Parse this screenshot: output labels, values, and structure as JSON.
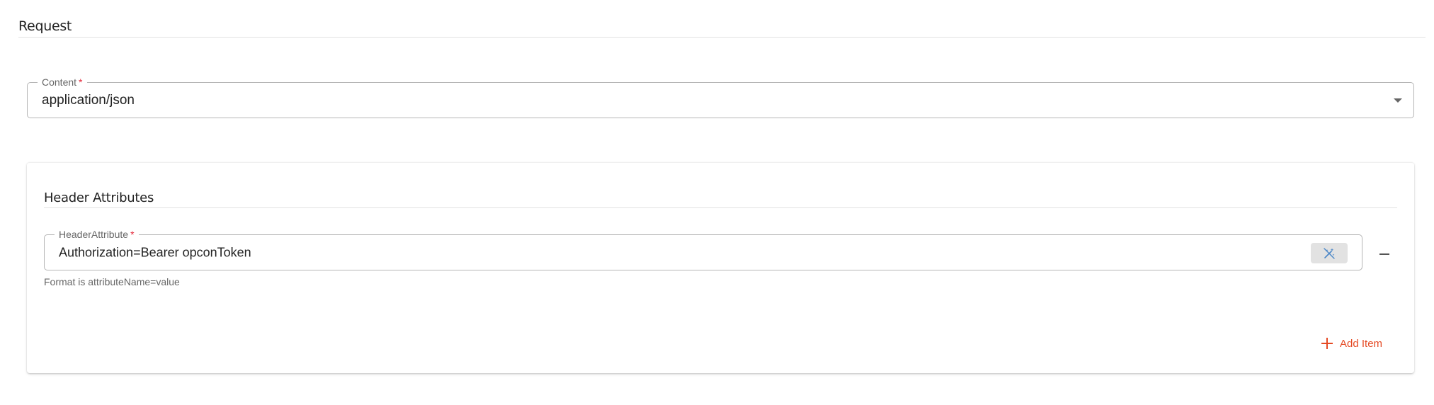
{
  "request": {
    "title": "Request"
  },
  "content_field": {
    "label": "Content",
    "required_mark": "*",
    "value": "application/json",
    "icon": "caret-down-icon"
  },
  "header_attributes": {
    "title": "Header Attributes",
    "items": [
      {
        "label": "HeaderAttribute",
        "required_mark": "*",
        "value": "Authorization=Bearer opconToken",
        "helper": "Format is attributeName=value",
        "action_icon": "magic-wand-icon",
        "remove_icon": "minus-icon"
      }
    ],
    "add_item_label": "Add Item",
    "add_item_icon": "plus-icon"
  },
  "colors": {
    "accent": "#e54a24",
    "required": "#e4283a",
    "wand": "#4a86c7"
  }
}
